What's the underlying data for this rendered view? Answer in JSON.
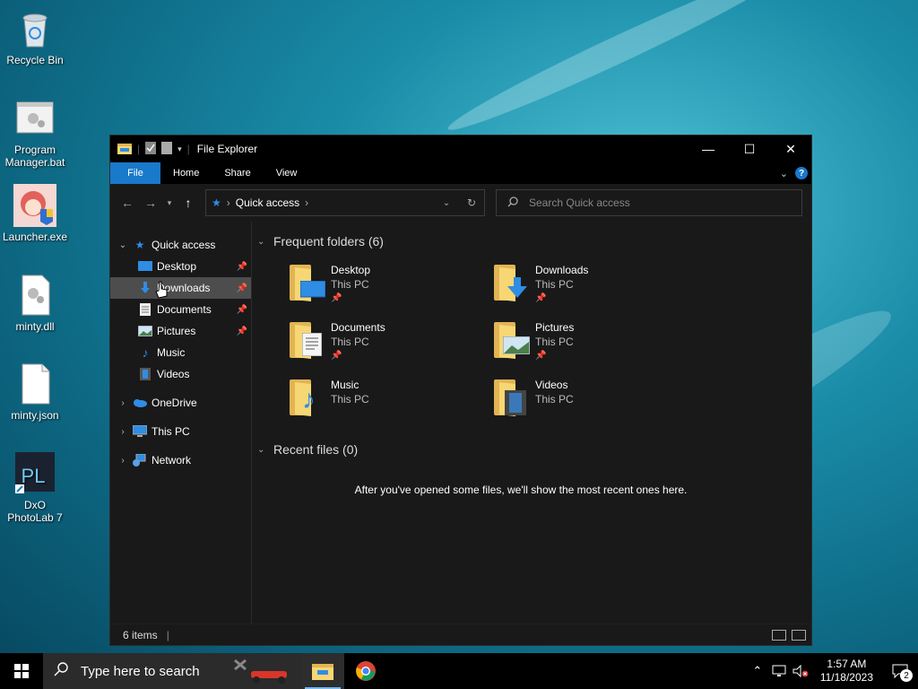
{
  "desktop": {
    "icons": [
      {
        "label": "Recycle Bin",
        "icon": "recycle-bin-icon"
      },
      {
        "label": "Program Manager.bat",
        "icon": "batch-file-icon"
      },
      {
        "label": "Launcher.exe",
        "icon": "launcher-app-icon"
      },
      {
        "label": "minty.dll",
        "icon": "dll-file-icon"
      },
      {
        "label": "minty.json",
        "icon": "json-file-icon"
      },
      {
        "label": "DxO PhotoLab 7",
        "icon": "dxo-photolab-icon"
      }
    ],
    "dxo_logo_text": "PL"
  },
  "window": {
    "title": "File Explorer",
    "controls": {
      "minimize": "—",
      "maximize": "☐",
      "close": "✕"
    },
    "ribbon": {
      "file": "File",
      "home": "Home",
      "share": "Share",
      "view": "View",
      "help": "?"
    },
    "address": {
      "location": "Quick access"
    },
    "search": {
      "placeholder": "Search Quick access"
    },
    "nav": {
      "quick_access": "Quick access",
      "items": [
        {
          "label": "Desktop",
          "pinned": true
        },
        {
          "label": "Downloads",
          "pinned": true
        },
        {
          "label": "Documents",
          "pinned": true
        },
        {
          "label": "Pictures",
          "pinned": true
        },
        {
          "label": "Music",
          "pinned": false
        },
        {
          "label": "Videos",
          "pinned": false
        }
      ],
      "onedrive": "OneDrive",
      "this_pc": "This PC",
      "network": "Network"
    },
    "frequent": {
      "header": "Frequent folders (6)",
      "folders": [
        {
          "name": "Desktop",
          "location": "This PC",
          "pinned": true
        },
        {
          "name": "Downloads",
          "location": "This PC",
          "pinned": true
        },
        {
          "name": "Documents",
          "location": "This PC",
          "pinned": true
        },
        {
          "name": "Pictures",
          "location": "This PC",
          "pinned": true
        },
        {
          "name": "Music",
          "location": "This PC",
          "pinned": false
        },
        {
          "name": "Videos",
          "location": "This PC",
          "pinned": false
        }
      ]
    },
    "recent": {
      "header": "Recent files (0)",
      "empty_message": "After you've opened some files, we'll show the most recent ones here."
    },
    "status": {
      "items": "6 items"
    }
  },
  "taskbar": {
    "search_placeholder": "Type here to search",
    "time": "1:57 AM",
    "date": "11/18/2023",
    "notification_count": "2"
  }
}
